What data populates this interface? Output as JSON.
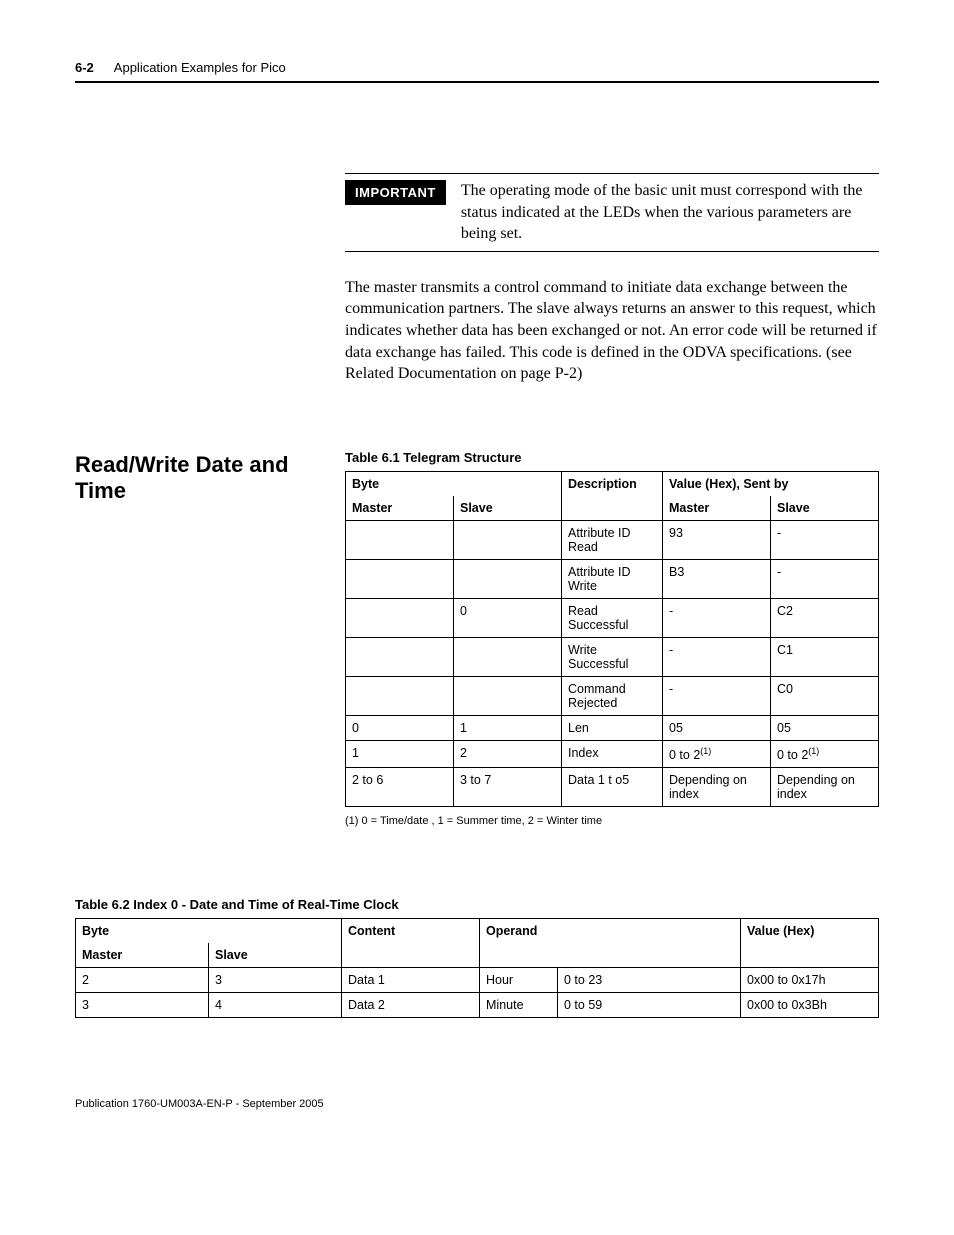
{
  "header": {
    "page_num": "6-2",
    "chapter": "Application Examples for Pico"
  },
  "important": {
    "label": "IMPORTANT",
    "text": "The operating mode of the basic unit must correspond with the status indicated at the LEDs when the various parameters are being set."
  },
  "body_para": "The master transmits a control command to initiate data exchange between the communication partners. The slave always returns an answer to this request, which indicates whether data has been exchanged or not. An error code will be returned if data exchange has failed. This code is defined in the ODVA specifications. (see Related Documentation on page P-2)",
  "section_heading": "Read/Write Date and Time",
  "table1": {
    "caption": "Table 6.1 Telegram Structure",
    "head": {
      "byte": "Byte",
      "desc": "Description",
      "value": "Value (Hex), Sent by",
      "master": "Master",
      "slave": "Slave"
    },
    "rows": [
      {
        "m": "",
        "s": "",
        "d": "Attribute ID Read",
        "vm": "93",
        "vs": "-"
      },
      {
        "m": "",
        "s": "",
        "d": "Attribute ID Write",
        "vm": "B3",
        "vs": "-"
      },
      {
        "m": "",
        "s": "0",
        "d": "Read Successful",
        "vm": "-",
        "vs": "C2"
      },
      {
        "m": "",
        "s": "",
        "d": "Write Successful",
        "vm": "-",
        "vs": "C1"
      },
      {
        "m": "",
        "s": "",
        "d": "Command Rejected",
        "vm": "-",
        "vs": "C0"
      },
      {
        "m": "0",
        "s": "1",
        "d": "Len",
        "vm": "05",
        "vs": "05"
      },
      {
        "m": "1",
        "s": "2",
        "d": "Index",
        "vm": "0 to 2",
        "vs": "0 to 2"
      },
      {
        "m": "2 to 6",
        "s": "3 to 7",
        "d": "Data 1 t o5",
        "vm": "Depending on index",
        "vs": "Depending on index"
      }
    ],
    "footnote_ref": "(1)",
    "footnote": "(1)   0 = Time/date , 1 = Summer time, 2 = Winter time"
  },
  "table2": {
    "caption": "Table 6.2 Index 0 - Date and Time of Real-Time Clock",
    "head": {
      "byte": "Byte",
      "content": "Content",
      "operand": "Operand",
      "value": "Value (Hex)",
      "master": "Master",
      "slave": "Slave"
    },
    "rows": [
      {
        "m": "2",
        "s": "3",
        "c": "Data 1",
        "o1": "Hour",
        "o2": "0 to 23",
        "v": "0x00 to 0x17h"
      },
      {
        "m": "3",
        "s": "4",
        "c": "Data 2",
        "o1": "Minute",
        "o2": "0 to 59",
        "v": "0x00 to 0x3Bh"
      }
    ]
  },
  "footer": "Publication 1760-UM003A-EN-P - September 2005"
}
